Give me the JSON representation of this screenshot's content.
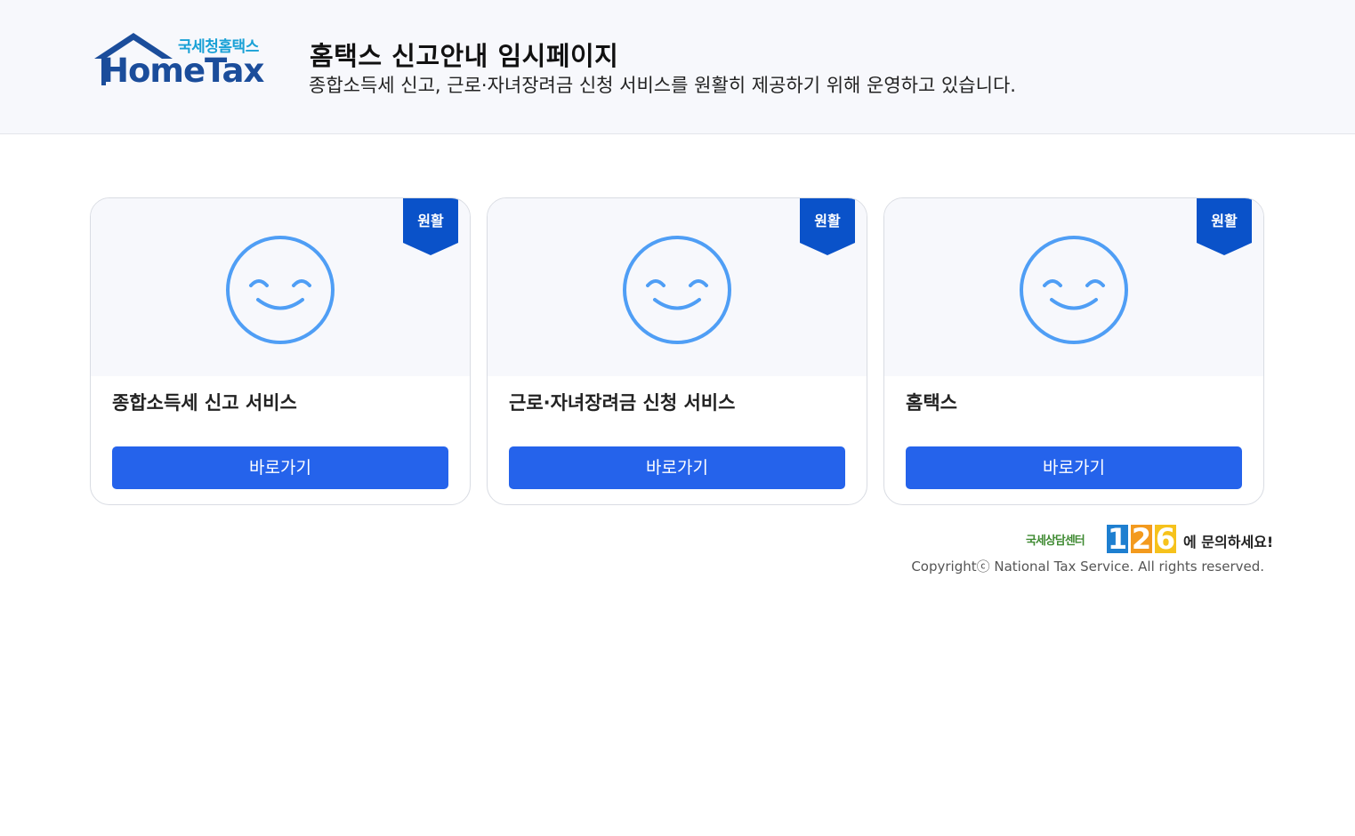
{
  "header": {
    "logo_kr": "국세청홈택스",
    "logo_en": "HomeTax",
    "title": "홈택스 신고안내 임시페이지",
    "subtitle": "종합소득세 신고, 근로·자녀장려금 신청 서비스를 원활히 제공하기 위해 운영하고 있습니다."
  },
  "cards": [
    {
      "status": "원활",
      "name": "종합소득세 신고 서비스",
      "button": "바로가기",
      "icon": "smiley-icon"
    },
    {
      "status": "원활",
      "name": "근로·자녀장려금 신청 서비스",
      "button": "바로가기",
      "icon": "smiley-icon"
    },
    {
      "status": "원활",
      "name": "홈택스",
      "button": "바로가기",
      "icon": "smiley-icon"
    }
  ],
  "footer": {
    "center_label": "국세상담센터",
    "center_number": "126",
    "center_tail": "에 문의하세요!",
    "copyright": "Copyrightⓒ National Tax Service. All rights reserved."
  },
  "colors": {
    "primary_button": "#2563eb",
    "ribbon": "#0a52c9",
    "smiley": "#4f9ef5",
    "header_bg": "#f7f8fc"
  }
}
